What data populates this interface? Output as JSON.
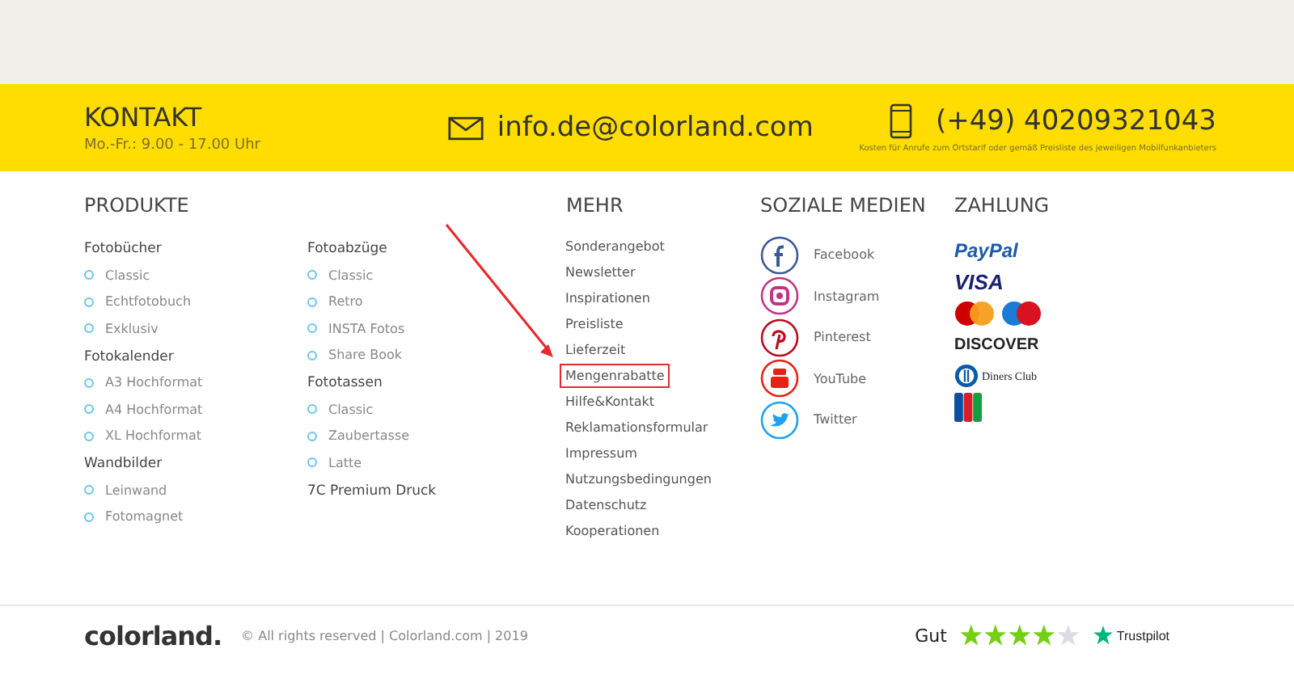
{
  "contact": {
    "title": "KONTAKT",
    "hours": "Mo.-Fr.: 9.00 - 17.00 Uhr",
    "email": "info.de@colorland.com",
    "phone": "(+49) 40209321043",
    "phone_note": "Kosten für Anrufe zum Ortstarif oder gemäß Preisliste des jeweiligen Mobilfunkanbieters"
  },
  "products": {
    "title": "PRODUKTE",
    "columns": [
      [
        {
          "name": "Fotobücher",
          "items": [
            "Classic",
            "Echtfotobuch",
            "Exklusiv"
          ]
        },
        {
          "name": "Fotokalender",
          "items": [
            "A3 Hochformat",
            "A4 Hochformat",
            "XL Hochformat"
          ]
        },
        {
          "name": "Wandbilder",
          "items": [
            "Leinwand",
            "Fotomagnet"
          ]
        }
      ],
      [
        {
          "name": "Fotoabzüge",
          "items": [
            "Classic",
            "Retro",
            "INSTA Fotos",
            "Share Book"
          ]
        },
        {
          "name": "Fototassen",
          "items": [
            "Classic",
            "Zaubertasse",
            "Latte"
          ]
        },
        {
          "name": "7C Premium Druck"
        }
      ]
    ]
  },
  "more": {
    "title": "MEHR",
    "items": [
      {
        "label": "Sonderangebot",
        "highlighted": false
      },
      {
        "label": "Newsletter",
        "highlighted": false
      },
      {
        "label": "Inspirationen",
        "highlighted": false
      },
      {
        "label": "Preisliste",
        "highlighted": false
      },
      {
        "label": "Lieferzeit",
        "highlighted": false
      },
      {
        "label": "Mengenrabatte",
        "highlighted": true
      },
      {
        "label": "Hilfe&Kontakt",
        "highlighted": false
      },
      {
        "label": "Reklamationsformular",
        "highlighted": false
      },
      {
        "label": "Impressum",
        "highlighted": false
      },
      {
        "label": "Nutzungsbedingungen",
        "highlighted": false
      },
      {
        "label": "Datenschutz",
        "highlighted": false
      },
      {
        "label": "Kooperationen",
        "highlighted": false
      }
    ]
  },
  "social": {
    "title": "SOZIALE MEDIEN",
    "items": [
      {
        "label": "Facebook",
        "kind": "facebook",
        "color": "#3b5998"
      },
      {
        "label": "Instagram",
        "kind": "instagram",
        "color": "#c13584"
      },
      {
        "label": "Pinterest",
        "kind": "pinterest",
        "color": "#bd081c"
      },
      {
        "label": "YouTube",
        "kind": "youtube",
        "color": "#e62117"
      },
      {
        "label": "Twitter",
        "kind": "twitter",
        "color": "#1da1f2"
      }
    ]
  },
  "payment": {
    "title": "ZAHLUNG",
    "items": [
      {
        "kind": "paypal",
        "label": "PayPal"
      },
      {
        "kind": "visa",
        "label": "VISA"
      },
      {
        "kind": "cards"
      },
      {
        "kind": "discover",
        "label": "DISCOVER"
      },
      {
        "kind": "diners",
        "label": "Diners Club"
      },
      {
        "kind": "jcb"
      }
    ]
  },
  "footer": {
    "logo": "colorland.",
    "copyright": "© All rights reserved | Colorland.com | 2019",
    "rating": "Gut",
    "stars": 4,
    "trustpilot": "Trustpilot"
  }
}
